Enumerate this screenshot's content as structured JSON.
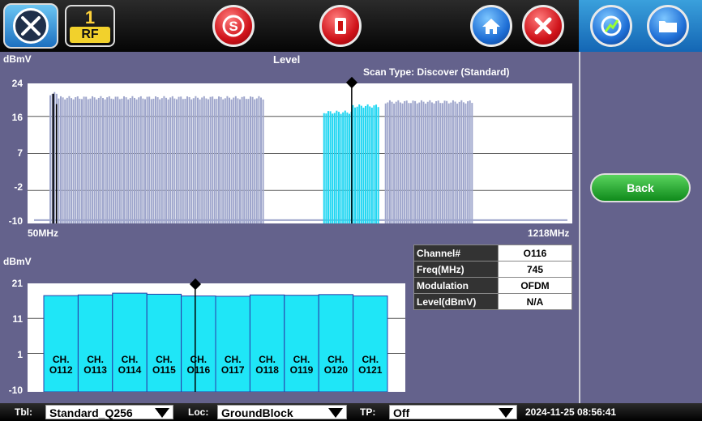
{
  "toolbar": {
    "rf_number": "1",
    "rf_label": "RF",
    "icons": [
      "tools-icon",
      "rf-badge",
      "scan-icon",
      "export-icon",
      "home-icon",
      "close-icon",
      "meter-icon",
      "folder-icon"
    ]
  },
  "top_chart": {
    "ylabel": "dBmV",
    "title": "Level",
    "scan_type": "Scan Type: Discover (Standard)",
    "yticks": [
      "24",
      "16",
      "7",
      "-2",
      "-10"
    ],
    "x_start": "50MHz",
    "x_end": "1218MHz"
  },
  "bottom_chart": {
    "ylabel": "dBmV",
    "yticks": [
      "21",
      "11",
      "1",
      "-10"
    ]
  },
  "info_table": {
    "rows": [
      {
        "key": "Channel#",
        "value": "O116"
      },
      {
        "key": "Freq(MHz)",
        "value": "745"
      },
      {
        "key": "Modulation",
        "value": "OFDM"
      },
      {
        "key": "Level(dBmV)",
        "value": "N/A"
      }
    ]
  },
  "back_label": "Back",
  "statusbar": {
    "tbl_label": "Tbl:",
    "tbl_value": "Standard_Q256",
    "loc_label": "Loc:",
    "loc_value": "GroundBlock",
    "tp_label": "TP:",
    "tp_value": "Off",
    "datetime": "2024-11-25  08:56:41"
  },
  "colors": {
    "background": "#64628c",
    "bar_normal": "#9fa6cc",
    "bar_selected": "#1fd6f2",
    "toolbar": "#0a0a0a"
  },
  "chart_data": [
    {
      "type": "bar",
      "title": "Level",
      "ylabel": "dBmV",
      "x_range_mhz": [
        50,
        1218
      ],
      "ylim": [
        -10,
        24
      ],
      "groups": [
        {
          "x_start_mhz": 97,
          "x_end_mhz": 115,
          "level": 21.5,
          "selected": false
        },
        {
          "x_start_mhz": 115,
          "x_end_mhz": 555,
          "level": 20.5,
          "selected": false
        },
        {
          "x_start_mhz": 684,
          "x_end_mhz": 746,
          "level": 17,
          "selected": true
        },
        {
          "x_start_mhz": 746,
          "x_end_mhz": 803,
          "level": 18.5,
          "selected": true
        },
        {
          "x_start_mhz": 816,
          "x_end_mhz": 1002,
          "level": 19.5,
          "selected": false
        }
      ],
      "marker_mhz": 745
    },
    {
      "type": "bar",
      "ylabel": "dBmV",
      "ylim": [
        -10,
        21
      ],
      "categories": [
        "CH. O112",
        "CH. O113",
        "CH. O114",
        "CH. O115",
        "CH. O116",
        "CH. O117",
        "CH. O118",
        "CH. O119",
        "CH. O120",
        "CH. O121"
      ],
      "values": [
        17.5,
        17.7,
        18.2,
        17.9,
        17.4,
        17.3,
        17.7,
        17.6,
        17.8,
        17.4
      ],
      "marker_index": 4
    }
  ]
}
